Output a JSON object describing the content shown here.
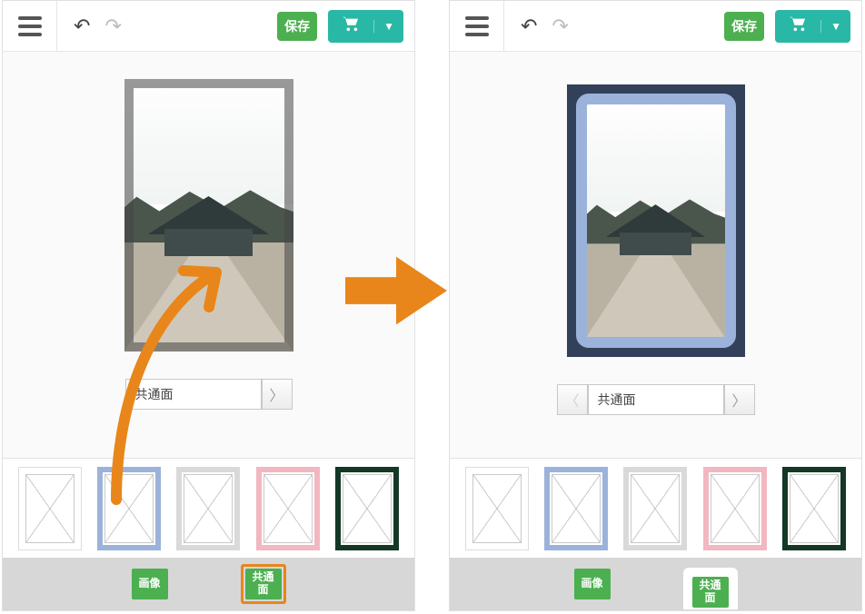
{
  "toolbar": {
    "save_label": "保存",
    "undo_glyph": "↶",
    "redo_glyph": "↷",
    "cart_dropdown_glyph": "▼"
  },
  "page_selector": {
    "label": "共通面",
    "prev_glyph": "〈",
    "next_glyph": "〉"
  },
  "frames": [
    {
      "id": "none",
      "color": "#dcdcdc"
    },
    {
      "id": "blue",
      "color": "#9bb3da"
    },
    {
      "id": "grey",
      "color": "#d9d9d9"
    },
    {
      "id": "pink",
      "color": "#f2b7c1"
    },
    {
      "id": "dgreen",
      "color": "#143726"
    }
  ],
  "tabs": {
    "image_label": "画像",
    "common_label": "共通\n面"
  },
  "state": {
    "left_selected_frame_index": 1,
    "right_selected_frame_index": 1,
    "left_selected_tab": "common",
    "right_selected_tab": "common"
  },
  "colors": {
    "accent_green": "#4CAF50",
    "accent_teal": "#29B8A5",
    "arrow_orange": "#E8861C"
  }
}
